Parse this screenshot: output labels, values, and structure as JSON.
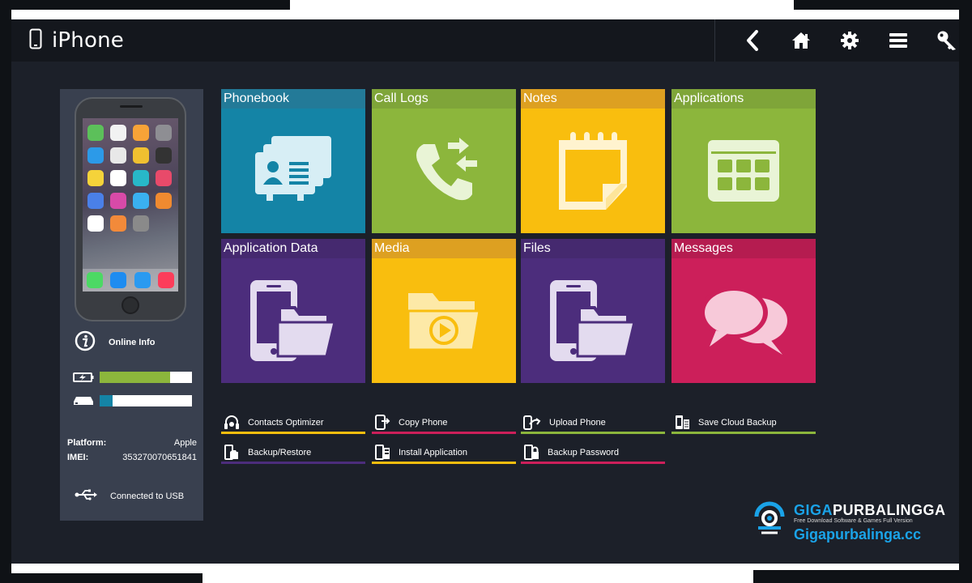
{
  "window": {
    "title": "iPhone"
  },
  "toolbar": {
    "icons": [
      "back-icon",
      "home-icon",
      "gear-icon",
      "menu-icon",
      "key-icon"
    ]
  },
  "device": {
    "online_info_label": "Online Info",
    "battery_level": 0.76,
    "storage_level": 0.14,
    "platform_label": "Platform:",
    "platform_value": "Apple",
    "imei_label": "IMEI:",
    "imei_value": "353270070651841",
    "connection_label": "Connected to USB"
  },
  "tiles": [
    {
      "label": "Phonebook",
      "color": "#1484a6",
      "header_color": "#237a98",
      "icon": "contacts-cards-icon"
    },
    {
      "label": "Call Logs",
      "color": "#8cb63c",
      "header_color": "#7fa539",
      "icon": "phone-arrows-icon"
    },
    {
      "label": "Notes",
      "color": "#f9be0e",
      "header_color": "#dda021",
      "icon": "notepad-icon"
    },
    {
      "label": "Applications",
      "color": "#8cb63c",
      "header_color": "#7fa539",
      "icon": "app-grid-icon"
    },
    {
      "label": "Application Data",
      "color": "#4c2d7c",
      "header_color": "#45296f",
      "icon": "phone-folder-icon"
    },
    {
      "label": "Media",
      "color": "#f9be0e",
      "header_color": "#dda021",
      "icon": "media-folder-icon"
    },
    {
      "label": "Files",
      "color": "#4c2d7c",
      "header_color": "#45296f",
      "icon": "phone-folder-icon"
    },
    {
      "label": "Messages",
      "color": "#cc1f5a",
      "header_color": "#b51c50",
      "icon": "chat-bubbles-icon"
    }
  ],
  "actions": [
    {
      "label": "Contacts Optimizer",
      "color": "#f9be0e",
      "icon": "headset-icon"
    },
    {
      "label": "Copy Phone",
      "color": "#cc1f5a",
      "icon": "copy-phone-icon"
    },
    {
      "label": "Upload Phone",
      "color": "#8cb63c",
      "icon": "upload-phone-icon"
    },
    {
      "label": "Save Cloud Backup",
      "color": "#8cb63c",
      "icon": "cloud-backup-icon"
    },
    {
      "label": "Backup/Restore",
      "color": "#4c2d7c",
      "icon": "backup-restore-icon"
    },
    {
      "label": "Install Application",
      "color": "#f9be0e",
      "icon": "install-app-icon"
    },
    {
      "label": "Backup Password",
      "color": "#cc1f5a",
      "icon": "backup-password-icon"
    }
  ],
  "watermark": {
    "brand_a": "GIGA",
    "brand_b": "PURBALINGGA",
    "tagline": "Free Download Software & Games Full Version",
    "url": "Gigapurbalinga.cc"
  }
}
